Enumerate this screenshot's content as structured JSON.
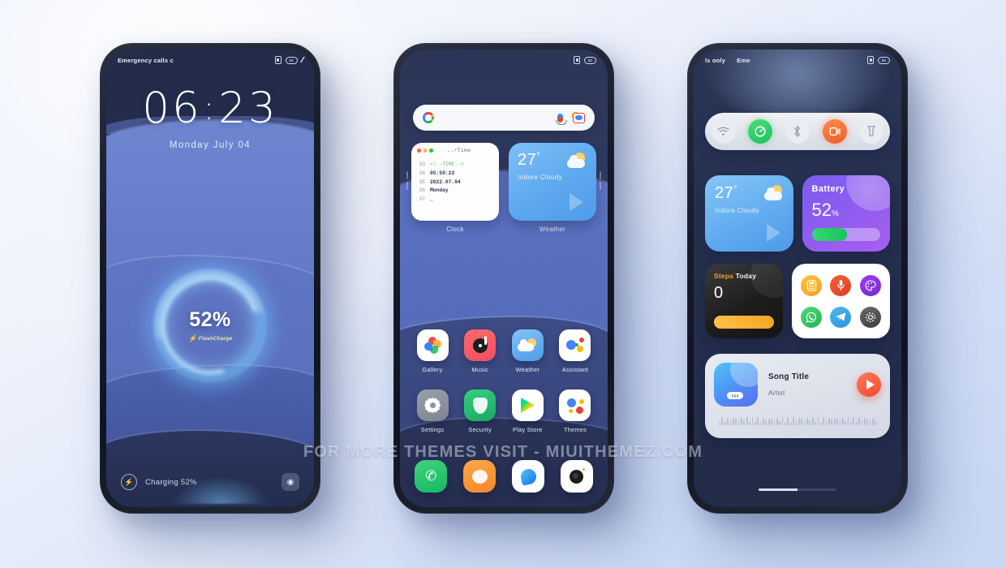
{
  "watermark": "FOR MORE THEMES VISIT - MIUITHEMEZ.COM",
  "colors": {
    "accent_blue": "#5d73c2",
    "wallpaper_dark": "#232c4a",
    "charge_glow": "#78c8ff",
    "battery_green": "#19c45f",
    "battery_widget_purple": "#8f5cf0",
    "play_button_red": "#f2492c",
    "steps_orange": "#f5a623"
  },
  "phone1": {
    "name": "lockscreen",
    "statusbar": {
      "carrier": "Emergency calls c",
      "icons": [
        "sim-icon",
        "battery-icon",
        "signal-icon"
      ],
      "battery_text": "52"
    },
    "clock": {
      "hours": "06",
      "separator": ":",
      "minutes": "23"
    },
    "date": "Monday  July  04",
    "charging": {
      "percent": "52%",
      "brand": "FlashCharge",
      "bolt": "⚡"
    },
    "footer": {
      "flash_icon": "⚡",
      "status": "Charging 52%",
      "camera_icon": "◉"
    }
  },
  "phone2": {
    "name": "homescreen",
    "statusbar": {
      "carrier": "",
      "battery_text": "52"
    },
    "search": {
      "placeholder": "",
      "value": "",
      "google_icon": "G",
      "mic_icon": "mic-icon",
      "lens_icon": "lens-icon"
    },
    "clock_widget": {
      "label": "Clock",
      "file_title": "../Time",
      "lines": [
        {
          "num": "33",
          "text": "<!--TIME-->",
          "type": "comment"
        },
        {
          "num": "34",
          "text": "05:50:22",
          "type": "code"
        },
        {
          "num": "35",
          "text": "2022.07.04",
          "type": "code"
        },
        {
          "num": "36",
          "text": "Monday",
          "type": "code"
        },
        {
          "num": "37",
          "text": "_",
          "type": "code"
        }
      ]
    },
    "weather_widget": {
      "label": "Weather",
      "temp": "27",
      "unit": "°",
      "desc": "Indore  Cloudy"
    },
    "apps_row1": [
      {
        "label": "Gallery",
        "icon": "gallery-icon"
      },
      {
        "label": "Music",
        "icon": "music-icon"
      },
      {
        "label": "Weather",
        "icon": "weather-icon"
      },
      {
        "label": "Assistant",
        "icon": "assistant-icon"
      }
    ],
    "apps_row2": [
      {
        "label": "Settings",
        "icon": "settings-icon"
      },
      {
        "label": "Security",
        "icon": "security-icon"
      },
      {
        "label": "Play Store",
        "icon": "play-store-icon"
      },
      {
        "label": "Themes",
        "icon": "themes-icon"
      }
    ],
    "dock": [
      {
        "label": "Phone",
        "icon": "phone-icon"
      },
      {
        "label": "Messages",
        "icon": "messages-icon"
      },
      {
        "label": "Browser",
        "icon": "browser-icon"
      },
      {
        "label": "Camera",
        "icon": "camera-icon"
      }
    ]
  },
  "phone3": {
    "name": "control-center",
    "statusbar": {
      "left1": "ls only",
      "left2": "Eme",
      "battery_text": "52"
    },
    "toggles": [
      {
        "name": "wifi-toggle",
        "icon": "▾",
        "state": "off"
      },
      {
        "name": "mobile-data-toggle",
        "icon": "◉",
        "state": "on"
      },
      {
        "name": "bluetooth-toggle",
        "icon": "✕",
        "state": "off"
      },
      {
        "name": "sound-toggle",
        "icon": "◧",
        "state": "on"
      },
      {
        "name": "flashlight-toggle",
        "icon": "▽",
        "state": "off"
      }
    ],
    "weather_widget": {
      "temp": "27",
      "unit": "°",
      "desc": "Indore  Cloudy"
    },
    "battery_widget": {
      "title": "Battery",
      "value": "52",
      "unit": "%",
      "fill_percent": 52
    },
    "steps_widget": {
      "title_accent": "Steps",
      "title_rest": " Today",
      "value": "0"
    },
    "shortcuts": [
      {
        "name": "calculator-shortcut",
        "icon": "▤"
      },
      {
        "name": "recorder-shortcut",
        "icon": "◓"
      },
      {
        "name": "themes-shortcut",
        "icon": "◔"
      },
      {
        "name": "whatsapp-shortcut",
        "icon": "◌"
      },
      {
        "name": "telegram-shortcut",
        "icon": "➤"
      },
      {
        "name": "settings-shortcut",
        "icon": "✷"
      }
    ],
    "music": {
      "title": "Song Title",
      "artist": "Artist",
      "play_icon": "▶"
    }
  }
}
